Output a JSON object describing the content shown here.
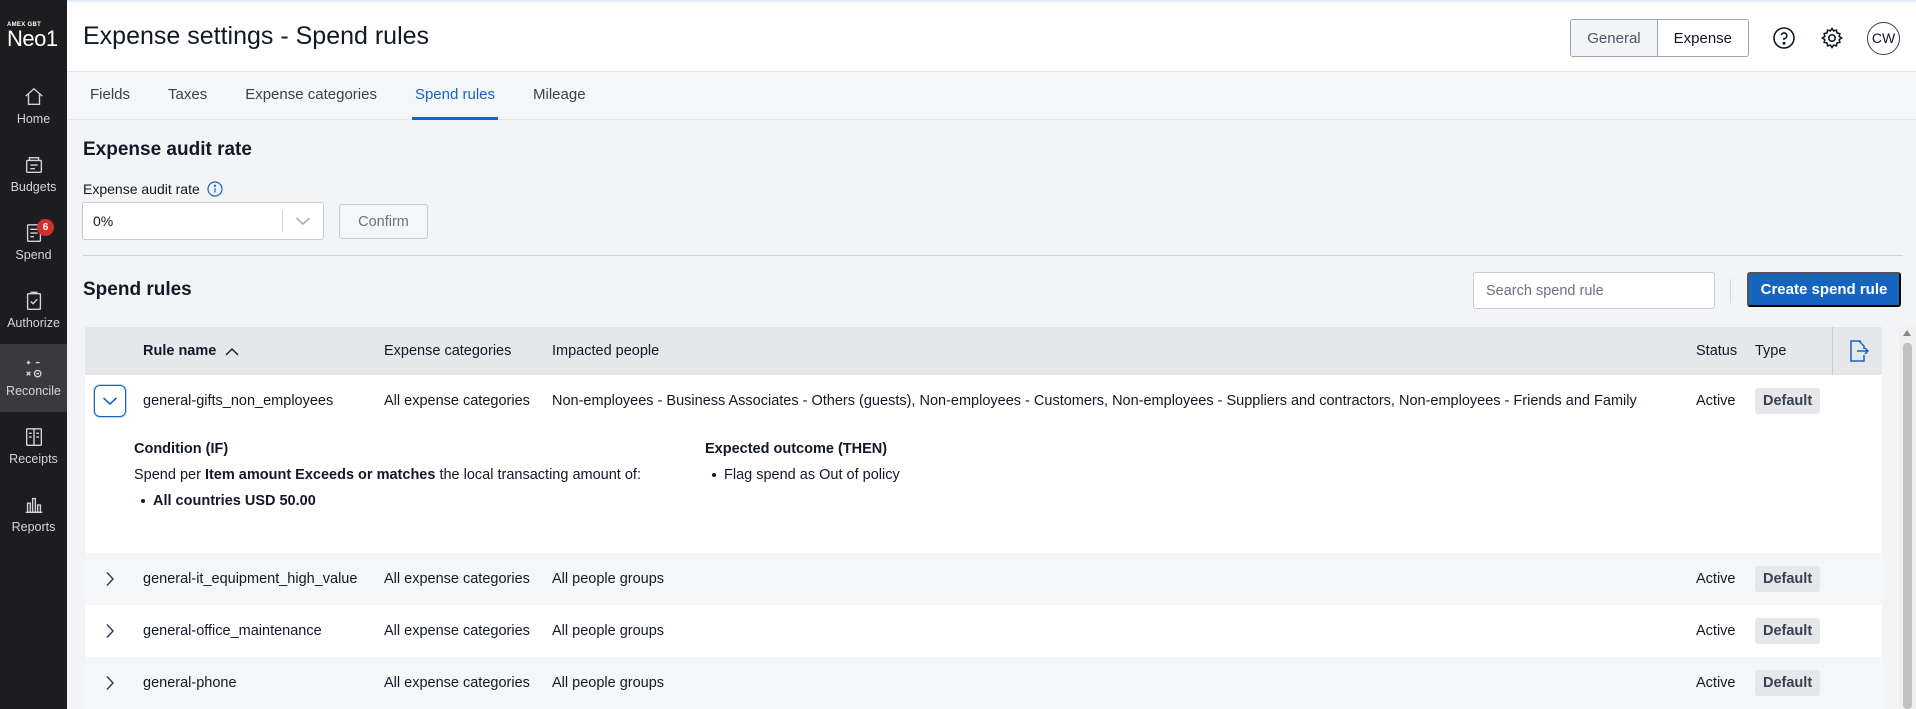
{
  "brand": {
    "small": "AMEX GBT",
    "big": "Neo1"
  },
  "sidebar": {
    "items": [
      {
        "label": "Home",
        "icon": "home-icon"
      },
      {
        "label": "Budgets",
        "icon": "budgets-icon"
      },
      {
        "label": "Spend",
        "icon": "spend-icon",
        "badge": "6"
      },
      {
        "label": "Authorize",
        "icon": "authorize-icon"
      },
      {
        "label": "Reconcile",
        "icon": "reconcile-icon",
        "active": true
      },
      {
        "label": "Receipts",
        "icon": "receipts-icon"
      },
      {
        "label": "Reports",
        "icon": "reports-icon"
      }
    ]
  },
  "header": {
    "title": "Expense settings - Spend rules",
    "toggle": {
      "general": "General",
      "expense": "Expense",
      "selected": "Expense"
    },
    "avatar": "CW"
  },
  "tabs": [
    {
      "label": "Fields"
    },
    {
      "label": "Taxes"
    },
    {
      "label": "Expense categories"
    },
    {
      "label": "Spend rules",
      "active": true
    },
    {
      "label": "Mileage"
    }
  ],
  "audit": {
    "title": "Expense audit rate",
    "label": "Expense audit rate",
    "value": "0%",
    "confirm": "Confirm"
  },
  "spend_rules": {
    "title": "Spend rules",
    "search_placeholder": "Search spend rule",
    "create": "Create spend rule",
    "columns": {
      "rule": "Rule name",
      "categories": "Expense categories",
      "people": "Impacted people",
      "status": "Status",
      "type": "Type"
    },
    "rows": [
      {
        "name": "general-gifts_non_employees",
        "categories": "All expense categories",
        "people": "Non-employees - Business Associates - Others (guests), Non-employees - Customers, Non-employees - Suppliers and contractors, Non-employees - Friends and Family",
        "status": "Active",
        "type": "Default",
        "expanded": true
      },
      {
        "name": "general-it_equipment_high_value",
        "categories": "All expense categories",
        "people": "All people groups",
        "status": "Active",
        "type": "Default"
      },
      {
        "name": "general-office_maintenance",
        "categories": "All expense categories",
        "people": "All people groups",
        "status": "Active",
        "type": "Default"
      },
      {
        "name": "general-phone",
        "categories": "All expense categories",
        "people": "All people groups",
        "status": "Active",
        "type": "Default"
      }
    ],
    "detail": {
      "condition_title": "Condition (IF)",
      "condition_pre": "Spend per ",
      "condition_bold": "Item amount Exceeds or matches",
      "condition_post": " the local transacting amount of:",
      "condition_bullet": "All countries USD 50.00",
      "outcome_title": "Expected outcome (THEN)",
      "outcome_bullet": "Flag spend as Out of policy"
    }
  },
  "colors": {
    "accent": "#1565c0",
    "sidebar": "#1d1d1f",
    "badge": "#d32f2f"
  }
}
